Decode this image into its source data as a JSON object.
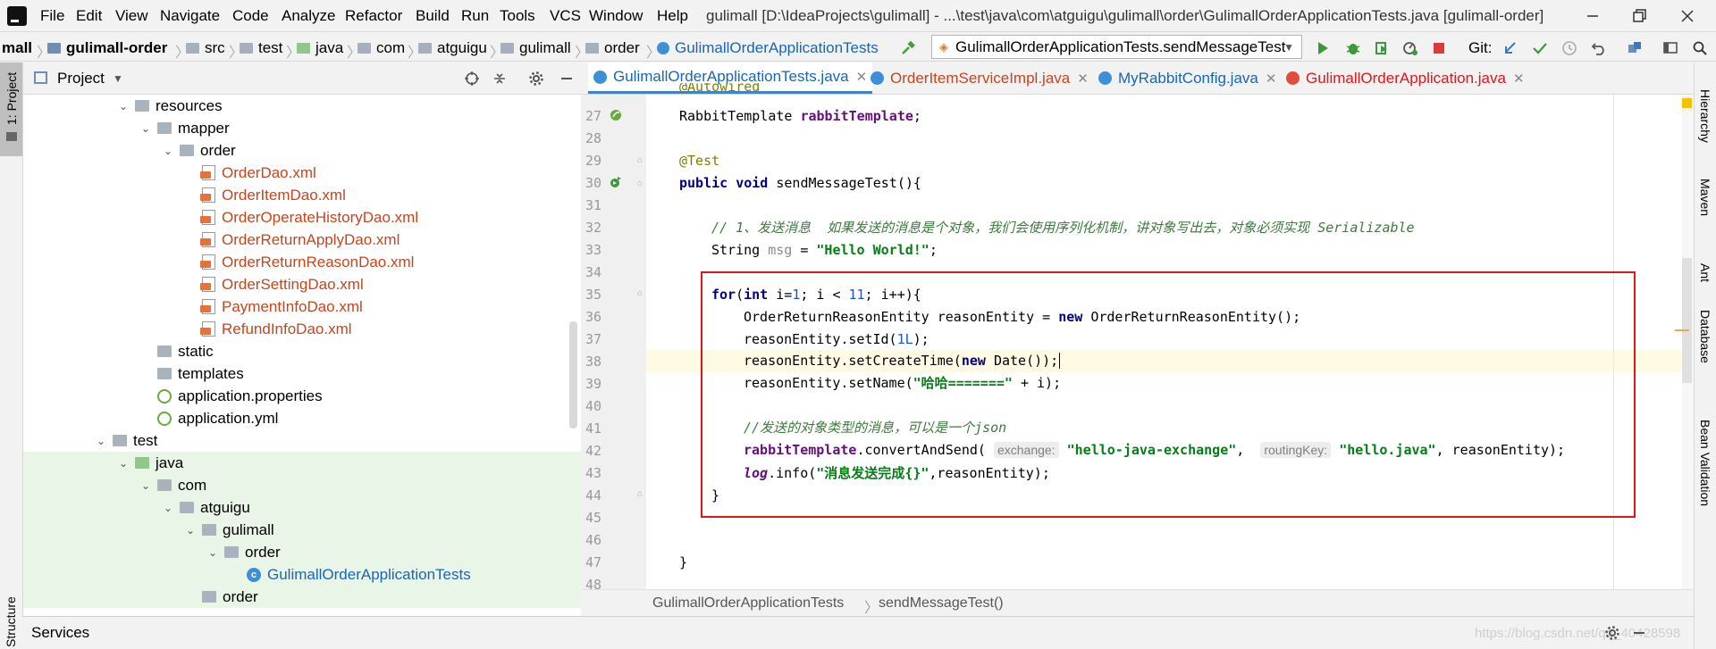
{
  "menu": {
    "items": [
      "File",
      "Edit",
      "View",
      "Navigate",
      "Code",
      "Analyze",
      "Refactor",
      "Build",
      "Run",
      "Tools",
      "VCS",
      "Window",
      "Help"
    ],
    "title": "gulimall [D:\\IdeaProjects\\gulimall] - ...\\test\\java\\com\\atguigu\\gulimall\\order\\GulimallOrderApplicationTests.java [gulimall-order]"
  },
  "nav": {
    "crumbs": [
      "mall",
      "gulimall-order",
      "src",
      "test",
      "java",
      "com",
      "atguigu",
      "gulimall",
      "order",
      "GulimallOrderApplicationTests"
    ],
    "run_config": "GulimallOrderApplicationTests.sendMessageTest",
    "git_label": "Git:"
  },
  "project": {
    "header": "Project",
    "side_tab": "1: Project",
    "structure_tab": "Structure",
    "tree": [
      {
        "label": "resources",
        "depth": 5,
        "kind": "folder",
        "chev": "v"
      },
      {
        "label": "mapper",
        "depth": 6,
        "kind": "folder",
        "chev": "v"
      },
      {
        "label": "order",
        "depth": 7,
        "kind": "folder",
        "chev": "v"
      },
      {
        "label": "OrderDao.xml",
        "depth": 8,
        "kind": "xml"
      },
      {
        "label": "OrderItemDao.xml",
        "depth": 8,
        "kind": "xml"
      },
      {
        "label": "OrderOperateHistoryDao.xml",
        "depth": 8,
        "kind": "xml"
      },
      {
        "label": "OrderReturnApplyDao.xml",
        "depth": 8,
        "kind": "xml"
      },
      {
        "label": "OrderReturnReasonDao.xml",
        "depth": 8,
        "kind": "xml"
      },
      {
        "label": "OrderSettingDao.xml",
        "depth": 8,
        "kind": "xml"
      },
      {
        "label": "PaymentInfoDao.xml",
        "depth": 8,
        "kind": "xml"
      },
      {
        "label": "RefundInfoDao.xml",
        "depth": 8,
        "kind": "xml"
      },
      {
        "label": "static",
        "depth": 6,
        "kind": "folder"
      },
      {
        "label": "templates",
        "depth": 6,
        "kind": "folder"
      },
      {
        "label": "application.properties",
        "depth": 6,
        "kind": "prop"
      },
      {
        "label": "application.yml",
        "depth": 6,
        "kind": "prop"
      },
      {
        "label": "test",
        "depth": 4,
        "kind": "folder",
        "chev": "v"
      },
      {
        "label": "java",
        "depth": 5,
        "kind": "folder-green",
        "chev": "v",
        "sel": true
      },
      {
        "label": "com",
        "depth": 6,
        "kind": "folder",
        "chev": "v",
        "sel": true
      },
      {
        "label": "atguigu",
        "depth": 7,
        "kind": "folder",
        "chev": "v",
        "sel": true
      },
      {
        "label": "gulimall",
        "depth": 8,
        "kind": "folder",
        "chev": "v",
        "sel": true
      },
      {
        "label": "order",
        "depth": 9,
        "kind": "folder",
        "chev": "v",
        "sel": true
      },
      {
        "label": "GulimallOrderApplicationTests",
        "depth": 10,
        "kind": "class",
        "sel": true
      },
      {
        "label": "order",
        "depth": 8,
        "kind": "folder",
        "sel": true
      }
    ]
  },
  "tabs": [
    {
      "label": "GulimallOrderApplicationTests.java",
      "active": true,
      "color": "#1a66b5"
    },
    {
      "label": "OrderItemServiceImpl.java",
      "color": "#c8451c"
    },
    {
      "label": "MyRabbitConfig.java",
      "color": "#1a66b5"
    },
    {
      "label": "GulimallOrderApplication.java",
      "color": "#e0161a"
    }
  ],
  "editor": {
    "line_numbers": [
      "27",
      "28",
      "29",
      "30",
      "31",
      "32",
      "33",
      "34",
      "35",
      "36",
      "37",
      "38",
      "39",
      "40",
      "41",
      "42",
      "43",
      "44",
      "45",
      "46",
      "47",
      "48"
    ],
    "partial_line": "@Autowired",
    "line27": {
      "type": "RabbitTemplate ",
      "field": "rabbitTemplate",
      "end": ";"
    },
    "line29": "@Test",
    "line30": {
      "kw": "public void ",
      "rest": "sendMessageTest(){"
    },
    "line32": "// 1、发送消息  如果发送的消息是个对象，我们会使用序列化机制，讲对象写出去，对象必须实现 Serializable",
    "line33": {
      "a": "String ",
      "var": "msg",
      "b": " = ",
      "str": "\"Hello World!\"",
      "end": ";"
    },
    "line35": {
      "kw1": "for",
      "a": "(",
      "kw2": "int ",
      "b": "i=",
      "n1": "1",
      "c": "; i < ",
      "n2": "11",
      "d": "; i++){"
    },
    "line36": {
      "a": "OrderReturnReasonEntity reasonEntity = ",
      "kw": "new ",
      "b": "OrderReturnReasonEntity();"
    },
    "line37": {
      "a": "reasonEntity.setId(",
      "n": "1L",
      "b": ");"
    },
    "line38": {
      "a": "reasonEntity.setCreateTime(",
      "kw": "new ",
      "b": "Date());"
    },
    "line39": {
      "a": "reasonEntity.setName(",
      "str": "\"哈哈=======\"",
      "b": " + i);"
    },
    "line41": "//发送的对象类型的消息，可以是一个json",
    "line42": {
      "fld": "rabbitTemplate",
      "a": ".convertAndSend( ",
      "h1": "exchange:",
      "s1": " \"hello-java-exchange\"",
      "b": ",  ",
      "h2": "routingKey:",
      "s2": " \"hello.java\"",
      "c": ", reasonEntity);"
    },
    "line43": {
      "st": "log",
      "a": ".info(",
      "str": "\"消息发送完成{}\"",
      "b": ",reasonEntity);"
    },
    "line44": "}",
    "line47": "}"
  },
  "breadcrumb": [
    "GulimallOrderApplicationTests",
    "sendMessageTest()"
  ],
  "right_tabs": [
    "Hierarchy",
    "Maven",
    "Ant",
    "Database",
    "Bean Validation"
  ],
  "services": {
    "label": "Services",
    "watermark": "https://blog.csdn.net/qq_40428598"
  }
}
